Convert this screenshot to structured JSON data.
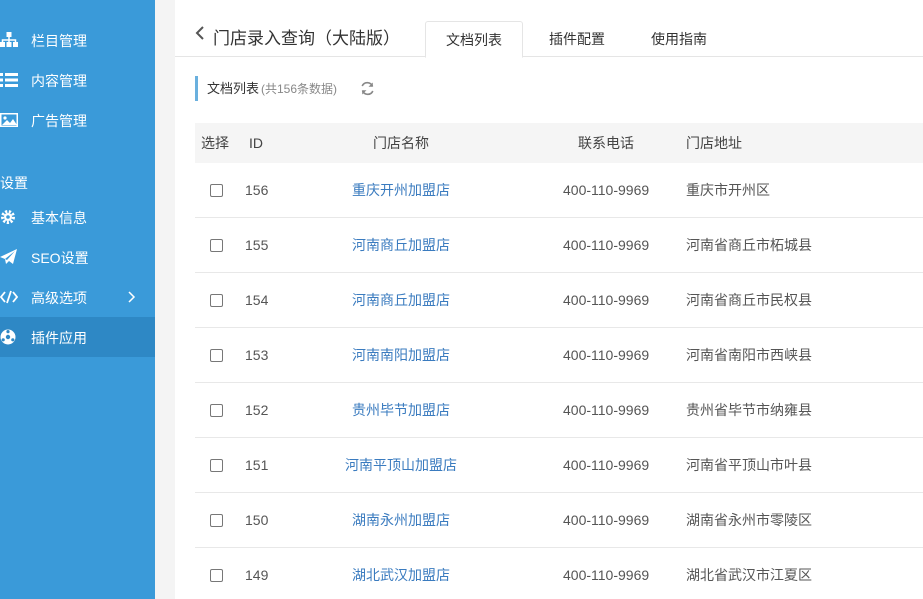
{
  "sidebar": {
    "items": [
      {
        "label": "栏目管理",
        "icon": "sitemap-icon"
      },
      {
        "label": "内容管理",
        "icon": "list-icon"
      },
      {
        "label": "广告管理",
        "icon": "image-icon"
      }
    ],
    "group_label": "设置",
    "settings": [
      {
        "label": "基本信息",
        "icon": "gear-icon"
      },
      {
        "label": "SEO设置",
        "icon": "send-icon"
      },
      {
        "label": "高级选项",
        "icon": "code-icon"
      },
      {
        "label": "插件应用",
        "icon": "plugin-icon"
      }
    ],
    "colors": {
      "bg": "#3a9ad9",
      "active": "#2e88c5"
    }
  },
  "header": {
    "title": "门店录入查询（大陆版）",
    "tabs": [
      {
        "label": "文档列表"
      },
      {
        "label": "插件配置"
      },
      {
        "label": "使用指南"
      }
    ]
  },
  "section": {
    "label": "文档列表",
    "count": "(共156条数据)"
  },
  "table": {
    "headers": {
      "select": "选择",
      "id": "ID",
      "name": "门店名称",
      "phone": "联系电话",
      "address": "门店地址"
    },
    "rows": [
      {
        "id": "156",
        "name": "重庆开州加盟店",
        "phone": "400-110-9969",
        "address": "重庆市开州区"
      },
      {
        "id": "155",
        "name": "河南商丘加盟店",
        "phone": "400-110-9969",
        "address": "河南省商丘市柘城县"
      },
      {
        "id": "154",
        "name": "河南商丘加盟店",
        "phone": "400-110-9969",
        "address": "河南省商丘市民权县"
      },
      {
        "id": "153",
        "name": "河南南阳加盟店",
        "phone": "400-110-9969",
        "address": "河南省南阳市西峡县"
      },
      {
        "id": "152",
        "name": "贵州毕节加盟店",
        "phone": "400-110-9969",
        "address": "贵州省毕节市纳雍县"
      },
      {
        "id": "151",
        "name": "河南平顶山加盟店",
        "phone": "400-110-9969",
        "address": "河南省平顶山市叶县"
      },
      {
        "id": "150",
        "name": "湖南永州加盟店",
        "phone": "400-110-9969",
        "address": "湖南省永州市零陵区"
      },
      {
        "id": "149",
        "name": "湖北武汉加盟店",
        "phone": "400-110-9969",
        "address": "湖北省武汉市江夏区"
      }
    ]
  }
}
